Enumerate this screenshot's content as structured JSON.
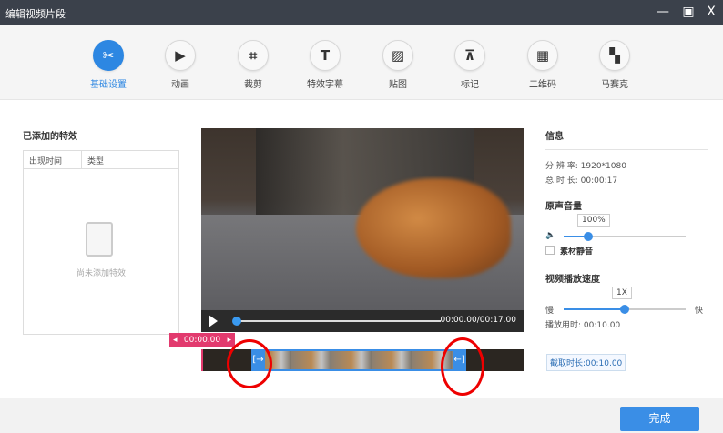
{
  "window": {
    "title": "编辑视频片段",
    "minimize": "—",
    "maximize": "▣",
    "close": "X"
  },
  "tabs": [
    {
      "label": "基础设置",
      "icon": "scissors-icon",
      "glyph": "✂",
      "active": true
    },
    {
      "label": "动画",
      "icon": "animation-icon",
      "glyph": "▶"
    },
    {
      "label": "裁剪",
      "icon": "crop-icon",
      "glyph": "⌗"
    },
    {
      "label": "特效字幕",
      "icon": "text-icon",
      "glyph": "T"
    },
    {
      "label": "贴图",
      "icon": "image-icon",
      "glyph": "▨"
    },
    {
      "label": "标记",
      "icon": "pin-icon",
      "glyph": "⊼"
    },
    {
      "label": "二维码",
      "icon": "qrcode-icon",
      "glyph": "▦"
    },
    {
      "label": "马赛克",
      "icon": "mosaic-icon",
      "glyph": "▚"
    }
  ],
  "effects": {
    "title": "已添加的特效",
    "columns": [
      "出现时间",
      "类型"
    ],
    "empty": "尚未添加特效"
  },
  "player": {
    "time": "00:00.00/00:17.00",
    "progress": 0,
    "marker_time": "00:00.00",
    "marker_prev": "◂",
    "marker_next": "▸",
    "trim_in": "[→",
    "trim_out": "←]"
  },
  "info": {
    "title": "信息",
    "resolution_label": "分 辨 率:",
    "resolution": "1920*1080",
    "duration_label": "总 时 长:",
    "duration": "00:00:17"
  },
  "volume": {
    "title": "原声音量",
    "value": "100%",
    "fraction": 0.2,
    "icon": "🔈",
    "mute_label": "素材静音",
    "muted": false
  },
  "speed": {
    "title": "视频播放速度",
    "value": "1X",
    "fraction": 0.5,
    "slow": "慢",
    "fast": "快",
    "play_time_label": "播放用时:",
    "play_time": "00:10.00"
  },
  "clip": {
    "label": "截取时长:00:10.00"
  },
  "footer": {
    "done": "完成"
  }
}
